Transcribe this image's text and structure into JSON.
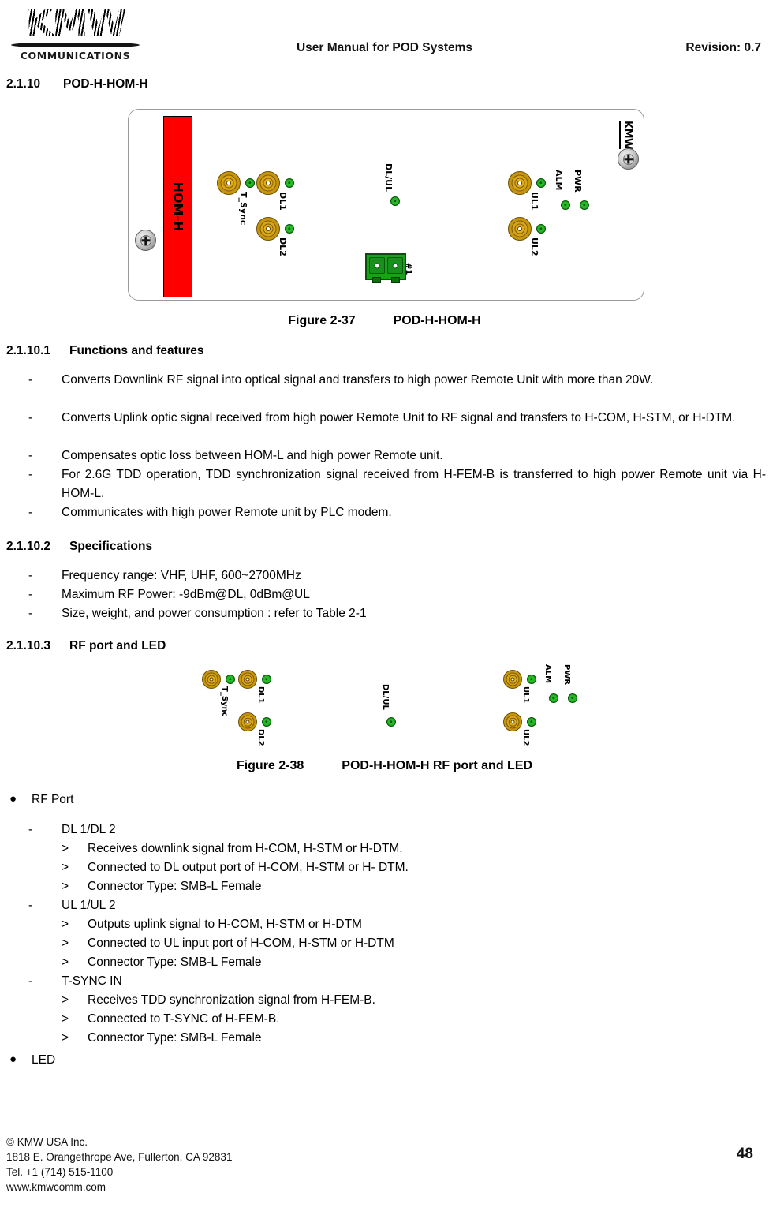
{
  "header": {
    "logo_text": "KMW",
    "logo_subtext": "COMMUNICATIONS",
    "title": "User Manual for POD Systems",
    "revision": "Revision: 0.7"
  },
  "section": {
    "number": "2.1.10",
    "title": "POD-H-HOM-H"
  },
  "figure_37": {
    "caption_number": "Figure 2-37",
    "caption_title": "POD-H-HOM-H",
    "module_label": "HOM-H",
    "brand_mark": "KMW",
    "ports": {
      "t_sync": "T_Sync",
      "dl1": "DL1",
      "dl2": "DL2",
      "dl_ul": "DL/UL",
      "ul1": "UL1",
      "ul2": "UL2",
      "alm": "ALM",
      "pwr": "PWR",
      "optical": "#1"
    },
    "colors": {
      "module_bar": "#ff0000",
      "led_green": "#22b522",
      "connector_gold": "#c8960c",
      "optical_green": "#1aa01a"
    }
  },
  "subsection_1": {
    "number": "2.1.10.1",
    "title": "Functions and features",
    "items": [
      "Converts Downlink RF signal into optical signal and transfers to high power Remote Unit with more than 20W.",
      "Converts Uplink optic signal received from high power Remote Unit to RF signal and transfers to H-COM, H-STM, or H-DTM.",
      "Compensates optic loss between HOM-L and high power Remote unit.",
      "For 2.6G TDD operation, TDD synchronization signal received from H-FEM-B is transferred to high power Remote unit via H-HOM-L.",
      "Communicates with high power Remote unit by PLC modem."
    ]
  },
  "subsection_2": {
    "number": "2.1.10.2",
    "title": "Specifications",
    "items": [
      "Frequency range: VHF, UHF, 600~2700MHz",
      "Maximum RF Power: -9dBm@DL, 0dBm@UL",
      "Size, weight, and power consumption : refer to Table 2-1"
    ]
  },
  "subsection_3": {
    "number": "2.1.10.3",
    "title": "RF port and LED"
  },
  "figure_38": {
    "caption_number": "Figure 2-38",
    "caption_title": "POD-H-HOM-H RF port and LED",
    "ports": {
      "t_sync": "T_Sync",
      "dl1": "DL1",
      "dl2": "DL2",
      "dl_ul": "DL/UL",
      "ul1": "UL1",
      "ul2": "UL2",
      "alm": "ALM",
      "pwr": "PWR"
    }
  },
  "rf_port": {
    "bullet": "RF Port",
    "groups": [
      {
        "label": "DL 1/DL 2",
        "details": [
          "Receives downlink signal from H-COM, H-STM or H-DTM.",
          "Connected to DL output port of H-COM, H-STM or H- DTM.",
          "Connector Type: SMB-L Female"
        ]
      },
      {
        "label": "UL 1/UL 2",
        "details": [
          "Outputs uplink signal to H-COM, H-STM or H-DTM",
          "Connected to UL input port of H-COM, H-STM or H-DTM",
          "Connector Type: SMB-L Female"
        ]
      },
      {
        "label": "T-SYNC IN",
        "details": [
          "Receives TDD synchronization signal from H-FEM-B.",
          "Connected to T-SYNC of H-FEM-B.",
          "Connector Type: SMB-L Female"
        ]
      }
    ]
  },
  "led_section": {
    "bullet": "LED"
  },
  "footer": {
    "line1": "© KMW USA Inc.",
    "line2": "1818 E. Orangethrope Ave, Fullerton, CA 92831",
    "line3": "Tel. +1 (714) 515-1100",
    "line4": "www.kmwcomm.com",
    "page_number": "48"
  }
}
